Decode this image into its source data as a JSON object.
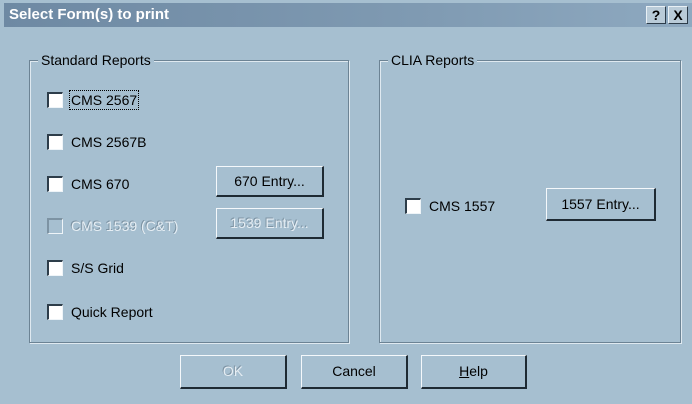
{
  "window": {
    "title": "Select Form(s) to print",
    "help_button": "?",
    "close_button": "X"
  },
  "standard_reports": {
    "title": "Standard Reports",
    "items": [
      {
        "label": "CMS 2567",
        "checked": false,
        "enabled": true
      },
      {
        "label": "CMS 2567B",
        "checked": false,
        "enabled": true
      },
      {
        "label": "CMS 670",
        "checked": false,
        "enabled": true
      },
      {
        "label": "CMS 1539 (C&T)",
        "checked": false,
        "enabled": false
      },
      {
        "label": "S/S Grid",
        "checked": false,
        "enabled": true
      },
      {
        "label": "Quick Report",
        "checked": false,
        "enabled": true
      }
    ],
    "entry_670": "670 Entry...",
    "entry_1539": "1539 Entry..."
  },
  "clia_reports": {
    "title": "CLIA Reports",
    "item": {
      "label": "CMS 1557",
      "checked": false,
      "enabled": true
    },
    "entry_1557": "1557 Entry..."
  },
  "buttons": {
    "ok": "OK",
    "cancel": "Cancel",
    "help_prefix": "H",
    "help_rest": "elp"
  }
}
